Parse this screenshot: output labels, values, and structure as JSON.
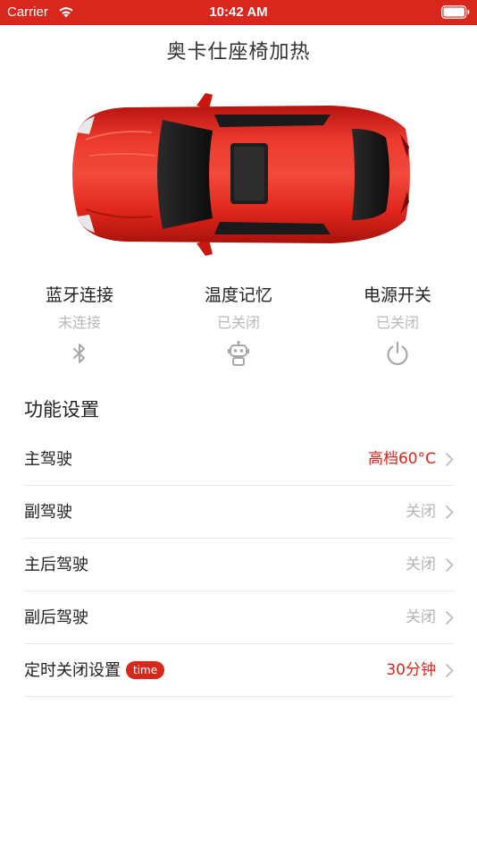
{
  "status_bar": {
    "carrier": "Carrier",
    "time": "10:42 AM",
    "background": "#d8271d"
  },
  "nav": {
    "title": "奥卡仕座椅加热"
  },
  "car": {
    "color": "#e0251c"
  },
  "controls": [
    {
      "title": "蓝牙连接",
      "status": "未连接",
      "icon": "bluetooth-icon"
    },
    {
      "title": "温度记忆",
      "status": "已关闭",
      "icon": "robot-icon"
    },
    {
      "title": "电源开关",
      "status": "已关闭",
      "icon": "power-icon"
    }
  ],
  "settings": {
    "title": "功能设置",
    "rows": [
      {
        "label": "主驾驶",
        "value": "高档60°C",
        "state": "on"
      },
      {
        "label": "副驾驶",
        "value": "关闭",
        "state": "off"
      },
      {
        "label": "主后驾驶",
        "value": "关闭",
        "state": "off"
      },
      {
        "label": "副后驾驶",
        "value": "关闭",
        "state": "off"
      },
      {
        "label": "定时关闭设置",
        "badge": "time",
        "value": "30分钟",
        "state": "on"
      }
    ]
  },
  "colors": {
    "accent": "#d8271d",
    "muted": "#b4b4b4",
    "divider": "#e6e6e6"
  }
}
